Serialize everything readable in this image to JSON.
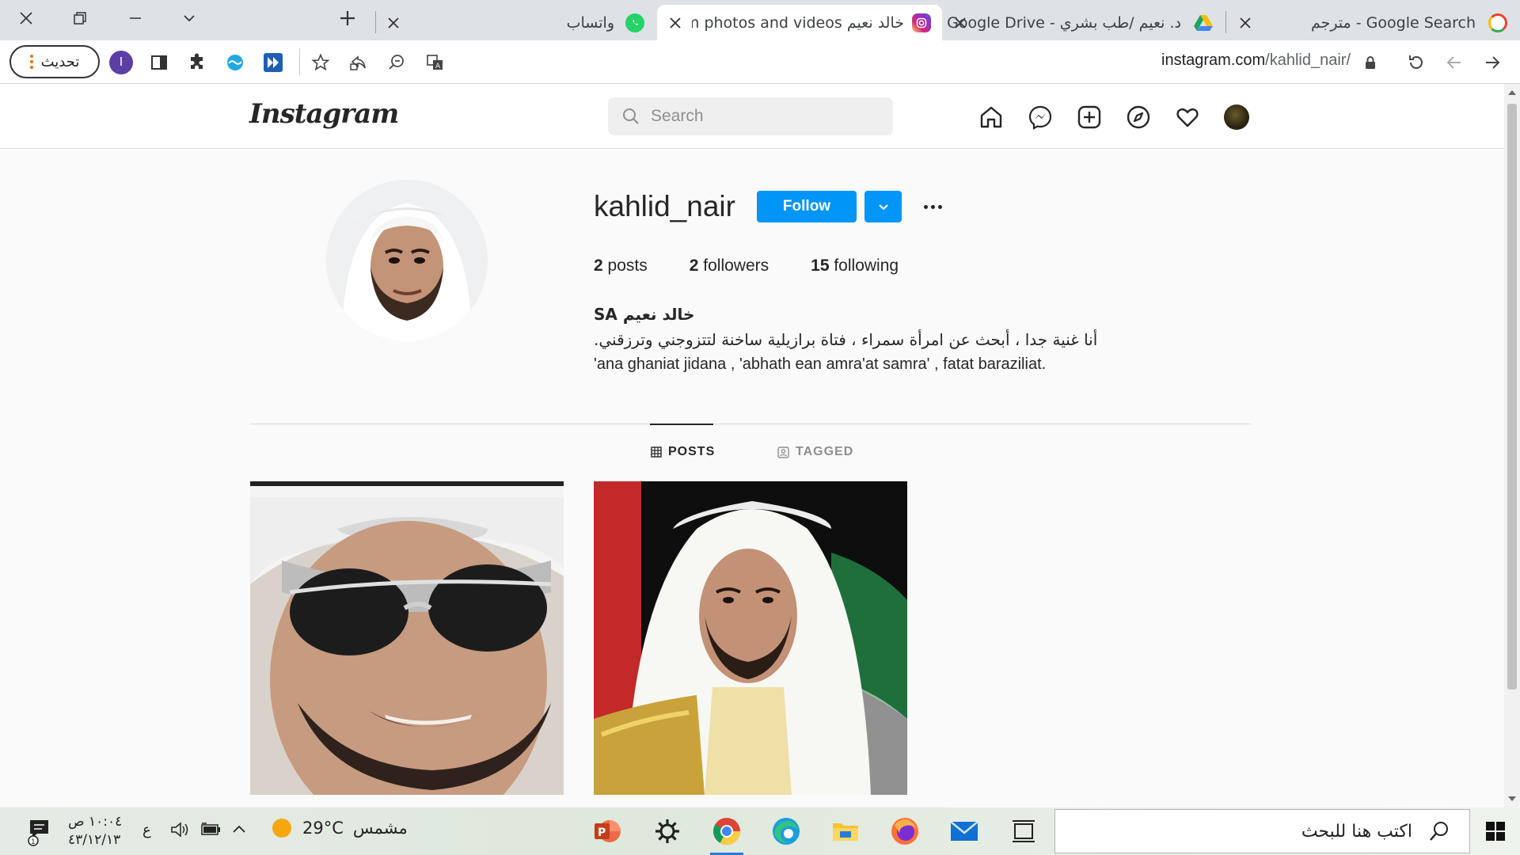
{
  "browser": {
    "tabs": [
      {
        "title": "Google Search - مترجم",
        "icon": "google-icon",
        "active": false
      },
      {
        "title": "د. نعيم /طب بشري - Google Drive",
        "icon": "google-drive-icon",
        "active": false
      },
      {
        "title": "خالد نعيم Instagram photos and videos",
        "icon": "instagram-icon",
        "active": true
      },
      {
        "title": "واتساب",
        "icon": "whatsapp-icon",
        "active": false
      }
    ],
    "update_button_label": "تحديث",
    "profile_initial": "I",
    "url_domain": "instagram.com",
    "url_path": "/kahlid_nair/"
  },
  "instagram": {
    "logo_text": "Instagram",
    "search_placeholder": "Search",
    "profile": {
      "username": "kahlid_nair",
      "follow_label": "Follow",
      "stats": {
        "posts_count": "2",
        "posts_label": "posts",
        "followers_count": "2",
        "followers_label": "followers",
        "following_count": "15",
        "following_label": "following"
      },
      "full_name": "خالد نعيم SA",
      "bio_line_1": "أنا غنية جدا ، أبحث عن امرأة سمراء ، فتاة برازيلية ساخنة لتتزوجني وترزقني.",
      "bio_line_2": "'ana ghaniat jidana , 'abhath ean amra'at samra' , fatat baraziliat."
    },
    "tabs": {
      "posts_label": "POSTS",
      "tagged_label": "TAGGED"
    },
    "posts_count": 2
  },
  "taskbar": {
    "search_placeholder": "اكتب هنا للبحث",
    "weather_temp": "29°C",
    "weather_desc": "مشمس",
    "language": "ع",
    "time": "١٠:٠٤ ص",
    "date": "٤٣/١٢/١٣",
    "notification_count": "1"
  },
  "colors": {
    "follow_blue": "#0095f6",
    "tabstrip_bg": "#dee1e6",
    "taskbar_accent": "#2b78d6"
  }
}
